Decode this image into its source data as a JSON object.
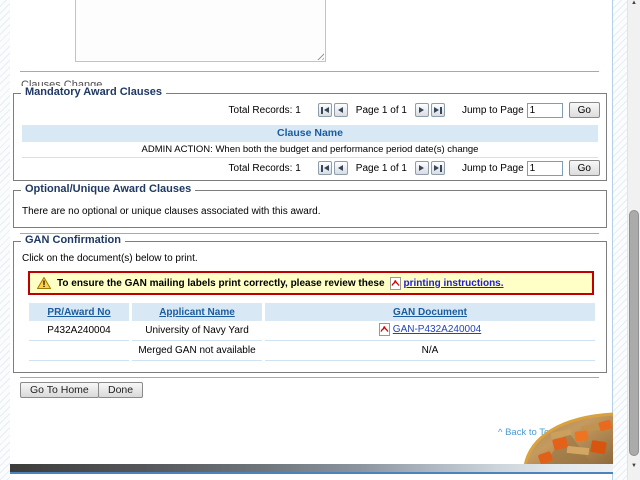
{
  "comment_box": {
    "value": ""
  },
  "clauses_change": {
    "label": "Clauses Change"
  },
  "mandatory": {
    "legend": "Mandatory Award Clauses",
    "pagination": {
      "total_records": "Total Records: 1",
      "page_status": "Page 1 of 1",
      "jump_label": "Jump to Page",
      "jump_value": "1",
      "go": "Go"
    },
    "header": "Clause Name",
    "rows": [
      {
        "clause_name": "ADMIN ACTION: When both the budget and performance period date(s) change"
      }
    ]
  },
  "optional": {
    "legend": "Optional/Unique Award Clauses",
    "message": "There are no optional or unique clauses associated with this award."
  },
  "gan": {
    "legend": "GAN Confirmation",
    "instruction": "Click on the document(s) below to print.",
    "warning_text": "To ensure the GAN mailing labels print correctly, please review these",
    "warning_link": "printing instructions.",
    "headers": [
      "PR/Award No",
      "Applicant Name",
      "GAN Document"
    ],
    "rows": [
      {
        "pr_award_no": "P432A240004",
        "applicant_name": "University of Navy Yard",
        "gan_document": "GAN-P432A240004"
      },
      {
        "pr_award_no": "",
        "applicant_name": "Merged GAN not available",
        "gan_document": "N/A"
      }
    ]
  },
  "actions": {
    "go_to_home": "Go To Home",
    "done": "Done"
  },
  "back_to_top": "^ Back to Top",
  "icons": {
    "first_page": "|<",
    "previous_page": "<",
    "next_page": ">",
    "last_page": ">|",
    "warning": "!",
    "pdf": "pdf-document",
    "scroll_up": "▲",
    "scroll_down": "▼",
    "textarea_resize": "diagonal-grip"
  },
  "colors": {
    "table_header_bg": "#d9e8f5",
    "table_header_text": "#1a5c9e",
    "warning_bg": "#ffffc6",
    "warning_border": "#c00000",
    "link_blue": "#2020cc",
    "divider_blue": "#85b1dc",
    "footer_line_blue": "#4f81bd",
    "legend_navy": "#1f3864"
  }
}
